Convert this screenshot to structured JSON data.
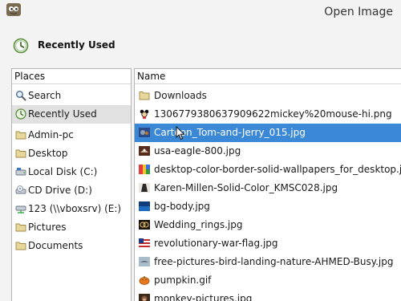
{
  "window": {
    "title": "Open Image",
    "app_icon": "gimp-icon"
  },
  "header": {
    "label": "Recently Used",
    "icon": "recent-clock-icon"
  },
  "places": {
    "header": "Places",
    "items": [
      {
        "label": "Search",
        "icon": "search-icon",
        "selected": false
      },
      {
        "label": "Recently Used",
        "icon": "recent-clock-icon",
        "selected": true
      },
      {
        "label": "Admin-pc",
        "icon": "folder-icon",
        "selected": false
      },
      {
        "label": "Desktop",
        "icon": "folder-icon",
        "selected": false
      },
      {
        "label": "Local Disk (C:)",
        "icon": "drive-icon",
        "selected": false
      },
      {
        "label": "CD Drive (D:)",
        "icon": "cd-drive-icon",
        "selected": false
      },
      {
        "label": "123 (\\\\vboxsrv) (E:)",
        "icon": "network-drive-icon",
        "selected": false
      },
      {
        "label": "Pictures",
        "icon": "folder-icon",
        "selected": false
      },
      {
        "label": "Documents",
        "icon": "folder-icon",
        "selected": false
      }
    ]
  },
  "files": {
    "header": "Name",
    "items": [
      {
        "name": "Downloads",
        "icon": "folder-icon",
        "selected": false
      },
      {
        "name": "1306779380637909622mickey%20mouse-hi.png",
        "icon": "image-thumb-icon",
        "selected": false
      },
      {
        "name": "Cartoon_Tom-and-Jerry_015.jpg",
        "icon": "image-thumb-icon",
        "selected": true
      },
      {
        "name": "usa-eagle-800.jpg",
        "icon": "image-thumb-icon",
        "selected": false
      },
      {
        "name": "desktop-color-border-solid-wallpapers_for_desktop.jpg",
        "icon": "image-thumb-icon",
        "selected": false
      },
      {
        "name": "Karen-Millen-Solid-Color_KMSC028.jpg",
        "icon": "image-thumb-icon",
        "selected": false
      },
      {
        "name": "bg-body.jpg",
        "icon": "image-thumb-icon",
        "selected": false
      },
      {
        "name": "Wedding_rings.jpg",
        "icon": "image-thumb-icon",
        "selected": false
      },
      {
        "name": "revolutionary-war-flag.jpg",
        "icon": "image-thumb-icon",
        "selected": false
      },
      {
        "name": "free-pictures-bird-landing-nature-AHMED-Busy.jpg",
        "icon": "image-thumb-icon",
        "selected": false
      },
      {
        "name": "pumpkin.gif",
        "icon": "image-thumb-icon",
        "selected": false
      },
      {
        "name": "monkey-pictures.jpg",
        "icon": "image-thumb-icon",
        "selected": false
      }
    ]
  },
  "colors": {
    "selection_blue": "#3b88d6",
    "selection_grey": "#e1e1e1",
    "folder_fill": "#e8d79b"
  }
}
